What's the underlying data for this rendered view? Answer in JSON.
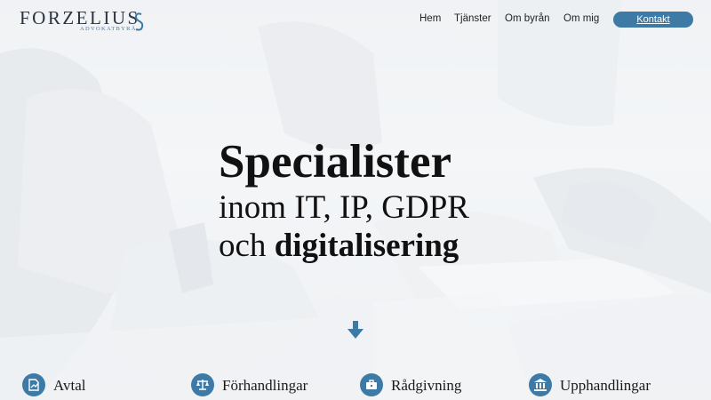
{
  "brand": {
    "name": "FORZELIUS",
    "tagline": "ADVOKATBYRÅ",
    "accent": "#3d7aa6"
  },
  "nav": {
    "items": [
      {
        "label": "Hem"
      },
      {
        "label": "Tjänster"
      },
      {
        "label": "Om byrån"
      },
      {
        "label": "Om mig"
      }
    ],
    "cta_label": "Kontakt"
  },
  "hero": {
    "title": "Specialister",
    "line2": "inom IT, IP, GDPR",
    "line3_prefix": "och ",
    "line3_bold": "digitalisering",
    "scroll_icon": "arrow-down-icon"
  },
  "services": [
    {
      "label": "Avtal",
      "icon": "contract-icon"
    },
    {
      "label": "Förhandlingar",
      "icon": "scales-icon"
    },
    {
      "label": "Rådgivning",
      "icon": "briefcase-icon"
    },
    {
      "label": "Upphandlingar",
      "icon": "institution-icon"
    }
  ]
}
